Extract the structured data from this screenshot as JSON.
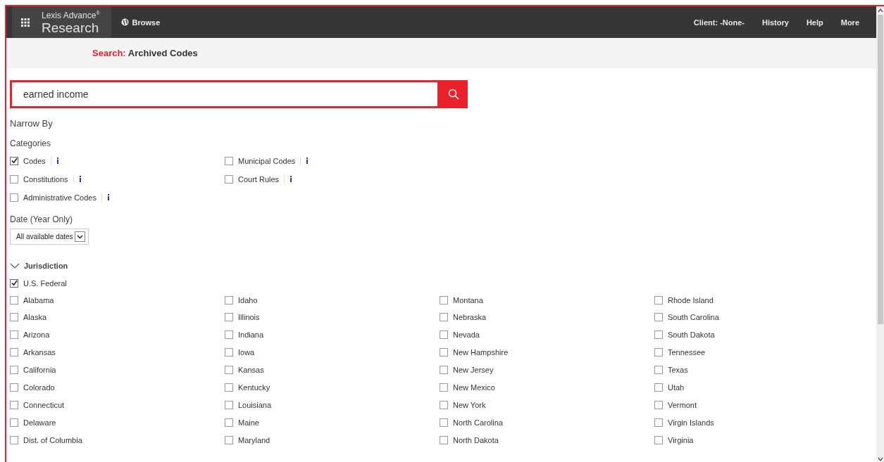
{
  "topbar": {
    "brand_top": "Lexis Advance",
    "brand_mark": "®",
    "brand_bottom": "Research",
    "browse": "Browse",
    "links": [
      "Client: -None-",
      "History",
      "Help",
      "More"
    ]
  },
  "subheader": {
    "prefix": "Search:",
    "title": "Archived Codes"
  },
  "search": {
    "value": "earned income"
  },
  "narrow_by": "Narrow By",
  "categories": {
    "heading": "Categories",
    "items": [
      {
        "label": "Codes",
        "checked": true
      },
      {
        "label": "Municipal Codes",
        "checked": false
      },
      {
        "label": "Constitutions",
        "checked": false
      },
      {
        "label": "Court Rules",
        "checked": false
      },
      {
        "label": "Administrative Codes",
        "checked": false
      }
    ]
  },
  "date": {
    "heading": "Date (Year Only)",
    "value": "All available dates"
  },
  "jurisdiction": {
    "heading": "Jurisdiction",
    "expanded": true,
    "federal": {
      "label": "U.S. Federal",
      "checked": true
    },
    "states": [
      {
        "label": "Alabama",
        "checked": false
      },
      {
        "label": "Alaska",
        "checked": false
      },
      {
        "label": "Arizona",
        "checked": false
      },
      {
        "label": "Arkansas",
        "checked": false
      },
      {
        "label": "California",
        "checked": false
      },
      {
        "label": "Colorado",
        "checked": false
      },
      {
        "label": "Connecticut",
        "checked": false
      },
      {
        "label": "Delaware",
        "checked": false
      },
      {
        "label": "Dist. of Columbia",
        "checked": false
      },
      {
        "label": "Idaho",
        "checked": false
      },
      {
        "label": "Illinois",
        "checked": false
      },
      {
        "label": "Indiana",
        "checked": false
      },
      {
        "label": "Iowa",
        "checked": false
      },
      {
        "label": "Kansas",
        "checked": false
      },
      {
        "label": "Kentucky",
        "checked": false
      },
      {
        "label": "Louisiana",
        "checked": false
      },
      {
        "label": "Maine",
        "checked": false
      },
      {
        "label": "Maryland",
        "checked": false
      },
      {
        "label": "Montana",
        "checked": false
      },
      {
        "label": "Nebraska",
        "checked": false
      },
      {
        "label": "Nevada",
        "checked": false
      },
      {
        "label": "New Hampshire",
        "checked": false
      },
      {
        "label": "New Jersey",
        "checked": false
      },
      {
        "label": "New Mexico",
        "checked": false
      },
      {
        "label": "New York",
        "checked": false
      },
      {
        "label": "North Carolina",
        "checked": false
      },
      {
        "label": "North Dakota",
        "checked": false
      },
      {
        "label": "Rhode Island",
        "checked": false
      },
      {
        "label": "South Carolina",
        "checked": false
      },
      {
        "label": "South Dakota",
        "checked": false
      },
      {
        "label": "Tennessee",
        "checked": false
      },
      {
        "label": "Texas",
        "checked": false
      },
      {
        "label": "Utah",
        "checked": false
      },
      {
        "label": "Vermont",
        "checked": false
      },
      {
        "label": "Virgin Islands",
        "checked": false
      },
      {
        "label": "Virginia",
        "checked": false
      }
    ]
  }
}
